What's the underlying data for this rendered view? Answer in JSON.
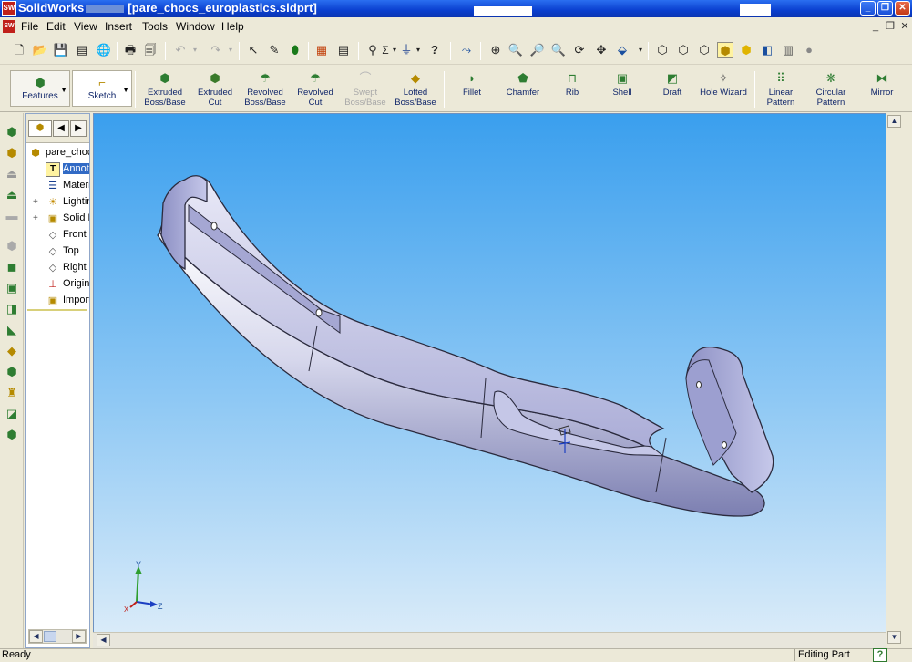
{
  "window": {
    "app_name": "SolidWorks",
    "title": "[pare_chocs_europlastics.sldprt]",
    "app_icon": "SW",
    "buttons": {
      "minimize": "_",
      "restore": "❐",
      "close": "✕"
    }
  },
  "menu": {
    "items": [
      "File",
      "Edit",
      "View",
      "Insert",
      "Tools",
      "Window",
      "Help"
    ],
    "mdi": {
      "minimize": "_",
      "restore": "❐",
      "close": "✕"
    }
  },
  "standard_toolbar": {
    "icons": [
      "new-icon",
      "open-icon",
      "save-icon",
      "print-preview-icon",
      "options-icon",
      "print-icon",
      "page-setup-icon",
      "undo-icon",
      "redo-icon",
      "select-icon",
      "sketch-pen-icon",
      "traffic-light-icon",
      "grid-icon",
      "table-icon",
      "measure-icon",
      "equation-icon",
      "help-pointer-icon",
      "smart-mates-icon",
      "zoom-fit-icon",
      "zoom-area-icon",
      "zoom-in-out-icon",
      "zoom-selection-icon",
      "rotate-icon",
      "pan-icon",
      "view-orient-icon",
      "wireframe-icon",
      "hidden-lines-visible-icon",
      "hidden-lines-removed-icon",
      "shaded-edges-icon",
      "shaded-icon",
      "section-view-icon",
      "realview-icon",
      "appearance-icon"
    ]
  },
  "command_manager": {
    "tabs": [
      {
        "label": "Features",
        "icon": "features-icon"
      },
      {
        "label": "Sketch",
        "icon": "sketch-icon"
      }
    ],
    "commands": [
      {
        "label1": "Extruded",
        "label2": "Boss/Base",
        "icon": "extruded-boss-icon",
        "enabled": true
      },
      {
        "label1": "Extruded",
        "label2": "Cut",
        "icon": "extruded-cut-icon",
        "enabled": true
      },
      {
        "label1": "Revolved",
        "label2": "Boss/Base",
        "icon": "revolved-boss-icon",
        "enabled": true
      },
      {
        "label1": "Revolved",
        "label2": "Cut",
        "icon": "revolved-cut-icon",
        "enabled": true
      },
      {
        "label1": "Swept",
        "label2": "Boss/Base",
        "icon": "swept-boss-icon",
        "enabled": false
      },
      {
        "label1": "Lofted",
        "label2": "Boss/Base",
        "icon": "lofted-boss-icon",
        "enabled": true
      },
      {
        "label1": "Fillet",
        "label2": "",
        "icon": "fillet-icon",
        "enabled": true
      },
      {
        "label1": "Chamfer",
        "label2": "",
        "icon": "chamfer-icon",
        "enabled": true
      },
      {
        "label1": "Rib",
        "label2": "",
        "icon": "rib-icon",
        "enabled": true
      },
      {
        "label1": "Shell",
        "label2": "",
        "icon": "shell-icon",
        "enabled": true
      },
      {
        "label1": "Draft",
        "label2": "",
        "icon": "draft-icon",
        "enabled": true
      },
      {
        "label1": "Hole Wizard",
        "label2": "",
        "icon": "hole-wizard-icon",
        "enabled": true
      },
      {
        "label1": "Linear",
        "label2": "Pattern",
        "icon": "linear-pattern-icon",
        "enabled": true
      },
      {
        "label1": "Circular",
        "label2": "Pattern",
        "icon": "circular-pattern-icon",
        "enabled": true
      },
      {
        "label1": "Mirror",
        "label2": "",
        "icon": "mirror-icon",
        "enabled": true
      }
    ]
  },
  "feature_tree": {
    "tabs": [
      "◀",
      "▶"
    ],
    "root": "pare_chocs_europlastics",
    "items": [
      {
        "label": "Annotations",
        "icon": "annotations-icon",
        "expand": "",
        "selected": true
      },
      {
        "label": "Material",
        "icon": "material-icon",
        "expand": "",
        "selected": false
      },
      {
        "label": "Lighting",
        "icon": "lighting-icon",
        "expand": "+",
        "selected": false
      },
      {
        "label": "Solid Bodies",
        "icon": "solid-bodies-icon",
        "expand": "+",
        "selected": false
      },
      {
        "label": "Front",
        "icon": "plane-icon",
        "expand": "",
        "selected": false
      },
      {
        "label": "Top",
        "icon": "plane-icon",
        "expand": "",
        "selected": false
      },
      {
        "label": "Right",
        "icon": "plane-icon",
        "expand": "",
        "selected": false
      },
      {
        "label": "Origin",
        "icon": "origin-icon",
        "expand": "",
        "selected": false
      },
      {
        "label": "Imported",
        "icon": "imported-icon",
        "expand": "",
        "selected": false
      }
    ]
  },
  "left_toolbar": {
    "icons": [
      "sketch-relation-icon",
      "extrude-icon",
      "revolve-icon",
      "sweep-icon",
      "loft-icon",
      "fillet-icon",
      "shell-icon",
      "draft-icon",
      "rib-icon",
      "dome-icon",
      "shape-icon",
      "flex-icon",
      "deform-icon",
      "wrap-icon",
      "mirror-icon"
    ]
  },
  "viewport": {
    "triad": {
      "x_label": "X",
      "y_label": "Y",
      "z_label": "Z"
    },
    "colors": {
      "bg_top": "#3a9fee",
      "bg_bottom": "#d9ebf9",
      "part": "#c7c9e6",
      "part_shadow": "#8b8fb8"
    }
  },
  "scrollbars": {
    "up": "▲",
    "down": "▼",
    "left": "◀",
    "right": "▶"
  },
  "status": {
    "left": "Ready",
    "right": "Editing Part",
    "help": "?"
  }
}
